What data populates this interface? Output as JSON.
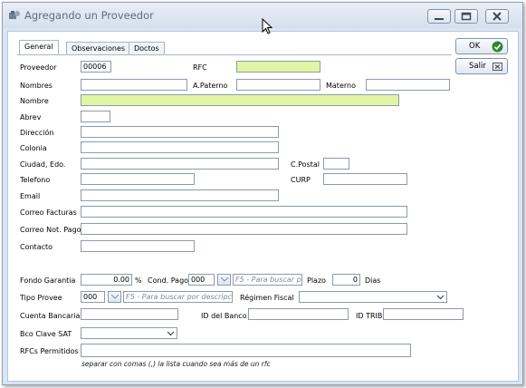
{
  "window": {
    "title": "Agregando un Proveedor",
    "controls": [
      "minimize-icon",
      "maximize-icon",
      "close-icon"
    ]
  },
  "tabs": [
    "General",
    "Observaciones",
    "Doctos"
  ],
  "actions": {
    "ok_label": "OK",
    "exit_label": "Salir"
  },
  "colors": {
    "required_field": "#e2f5a5",
    "ok_icon": "#2e8b2e"
  },
  "form": {
    "proveedor_label": "Proveedor",
    "proveedor_value": "00006",
    "rfc_label": "RFC",
    "rfc_value": "",
    "nombres_label": "Nombres",
    "nombres_value": "",
    "apaterno_label": "A.Paterno",
    "apaterno_value": "",
    "materno_label": "Materno",
    "materno_value": "",
    "nombre_label": "Nombre",
    "nombre_value": "",
    "abrev_label": "Abrev",
    "abrev_value": "",
    "direccion_label": "Dirección",
    "direccion_value": "",
    "colonia_label": "Colonia",
    "colonia_value": "",
    "ciudad_label": "Ciudad, Edo.",
    "ciudad_value": "",
    "cpostal_label": "C.Postal",
    "cpostal_value": "",
    "telefono_label": "Telefono",
    "telefono_value": "",
    "curp_label": "CURP",
    "curp_value": "",
    "email_label": "Email",
    "email_value": "",
    "correo_facturas_label": "Correo Facturas",
    "correo_facturas_value": "",
    "correo_pago_label": "Correo Not. Pago",
    "correo_pago_value": "",
    "contacto_label": "Contacto",
    "contacto_value": "",
    "fondo_label": "Fondo Garantia",
    "fondo_value": "0.00",
    "percent_sign": "%",
    "cond_pago_label": "Cond. Pago",
    "cond_pago_code": "000",
    "cond_pago_placeholder": "F5 - Para buscar por",
    "plazo_label": "Plazo",
    "plazo_value": "0",
    "dias_label": "Dias",
    "tipo_provee_label": "Tipo Provee",
    "tipo_provee_code": "000",
    "tipo_provee_placeholder": "F5 - Para buscar por descripción",
    "regimen_label": "Régimen Fiscal",
    "regimen_value": "",
    "cuenta_label": "Cuenta Bancaria",
    "cuenta_value": "",
    "id_banco_label": "ID del Banco",
    "id_banco_value": "",
    "id_trib_label": "ID TRIB",
    "id_trib_value": "",
    "bco_clave_label": "Bco Clave SAT",
    "bco_clave_value": "",
    "rfcs_label": "RFCs Permitidos",
    "rfcs_value": "",
    "rfcs_hint": "separar con comas (,) la lista cuando sea más de un rfc"
  }
}
